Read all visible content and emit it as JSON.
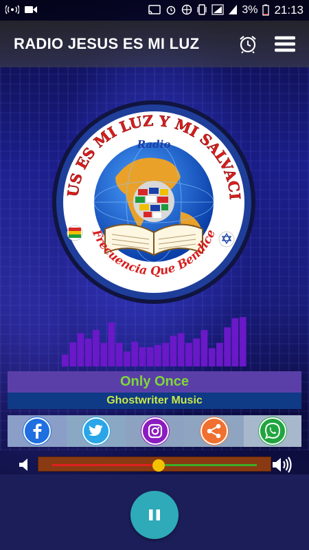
{
  "status_bar": {
    "battery": "3%",
    "time": "21:13",
    "icons": [
      "hotspot-icon",
      "video-icon",
      "cast-icon",
      "alarm-icon",
      "vpn-icon",
      "vibrate-icon",
      "signal-icon",
      "battery-icon"
    ]
  },
  "app_bar": {
    "title": "RADIO JESUS ES MI LUZ",
    "icons": [
      "alarm-clock-icon",
      "hamburger-menu-icon"
    ]
  },
  "logo": {
    "arc_text": "JESUS ES MI LUZ Y MI SALVACION",
    "inner_label": "Radio",
    "bottom_text": "Frecuencia Que Bendice"
  },
  "equalizer": {
    "levels": [
      0.22,
      0.45,
      0.62,
      0.52,
      0.68,
      0.44,
      0.82,
      0.44,
      0.28,
      0.46,
      0.36,
      0.36,
      0.4,
      0.44,
      0.57,
      0.62,
      0.44,
      0.52,
      0.68,
      0.34,
      0.44,
      0.73,
      0.9,
      0.92
    ]
  },
  "now_playing": {
    "title": "Only Once",
    "artist": "Ghostwriter Music"
  },
  "social": [
    {
      "name": "facebook",
      "color": "#1e6fe0",
      "bg": "#8a9ec8"
    },
    {
      "name": "twitter",
      "color": "#2aa5e8",
      "bg": "#8aa8c4"
    },
    {
      "name": "instagram",
      "color": "#8b1cc0",
      "bg": "#8da2c0"
    },
    {
      "name": "share",
      "color": "#f07030",
      "bg": "#8ea4c0"
    },
    {
      "name": "whatsapp",
      "color": "#21a540",
      "bg": "#a8b8cc"
    }
  ],
  "volume": {
    "level": 0.52
  },
  "player": {
    "state": "playing",
    "button_icon": "pause-icon"
  }
}
